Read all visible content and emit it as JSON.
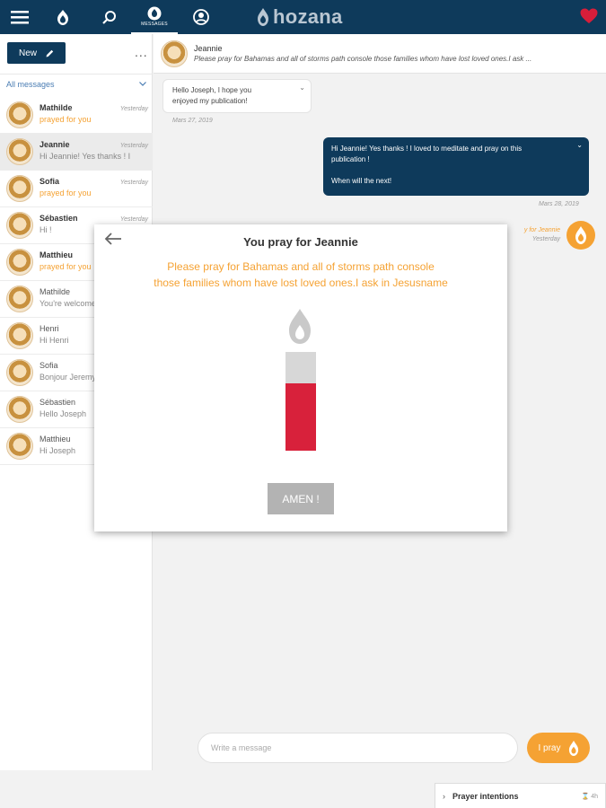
{
  "topbar": {
    "messages_label": "MESSAGES",
    "logo_text": "hozana",
    "icons": [
      "menu-icon",
      "home-icon",
      "search-icon",
      "messages-icon",
      "profile-icon",
      "heart-icon"
    ]
  },
  "sidebar": {
    "new_label": "New",
    "more_label": "...",
    "filter_label": "All messages",
    "conversations": [
      {
        "name": "Mathilde",
        "time": "Yesterday",
        "preview": "prayed for you",
        "preview_style": "orange",
        "unread": true,
        "active": false
      },
      {
        "name": "Jeannie",
        "time": "Yesterday",
        "preview": "Hi Jeannie! Yes thanks ! I",
        "preview_style": "gray",
        "unread": true,
        "active": true
      },
      {
        "name": "Sofia",
        "time": "Yesterday",
        "preview": "prayed for you",
        "preview_style": "orange",
        "unread": true,
        "active": false
      },
      {
        "name": "Sébastien",
        "time": "Yesterday",
        "preview": "Hi !",
        "preview_style": "gray",
        "unread": true,
        "active": false
      },
      {
        "name": "Matthieu",
        "time": "",
        "preview": "prayed for you",
        "preview_style": "orange",
        "unread": true,
        "active": false
      },
      {
        "name": "Mathilde",
        "time": "",
        "preview": "You're welcome",
        "preview_style": "gray",
        "unread": false,
        "active": false
      },
      {
        "name": "Henri",
        "time": "",
        "preview": "Hi Henri",
        "preview_style": "gray",
        "unread": false,
        "active": false
      },
      {
        "name": "Sofia",
        "time": "",
        "preview": "Bonjour Jeremy",
        "preview_style": "gray",
        "unread": false,
        "active": false
      },
      {
        "name": "Sébastien",
        "time": "",
        "preview": "Hello Joseph",
        "preview_style": "gray",
        "unread": false,
        "active": false
      },
      {
        "name": "Matthieu",
        "time": "",
        "preview": "Hi Joseph",
        "preview_style": "gray",
        "unread": false,
        "active": false
      }
    ]
  },
  "chat": {
    "contact_name": "Jeannie",
    "intention": "Please pray for Bahamas and all of storms path console those families whom have lost loved ones.I ask ...",
    "incoming_line1": "Hello Joseph, I hope you",
    "incoming_line2": "enjoyed my publication!",
    "incoming_time": "Mars 27, 2019",
    "outgoing_line1": "Hi Jeannie! Yes thanks ! I loved to meditate and pray on this",
    "outgoing_line2": "publication !",
    "outgoing_line3": "When will the next!",
    "outgoing_time": "Mars 28, 2019",
    "pray_note": "y for Jeannie",
    "pray_note_time": "Yesterday"
  },
  "composer": {
    "placeholder": "Write a message",
    "pray_label": "I pray"
  },
  "prayer_tab": {
    "title": "Prayer intentions",
    "time": "4h"
  },
  "modal": {
    "title": "You pray for Jeannie",
    "text_line1": "Please pray for Bahamas and all of storms path console",
    "text_line2": "those families whom have lost loved ones.I ask in Jesusname",
    "amen_label": "AMEN !",
    "candle_colors": {
      "flame": "#c9c9c9",
      "wax_top": "#d7d7d7",
      "wax": "#d8213b"
    }
  },
  "colors": {
    "navy": "#0e3a5b",
    "orange": "#f5a233",
    "heart": "#d81e3a"
  }
}
